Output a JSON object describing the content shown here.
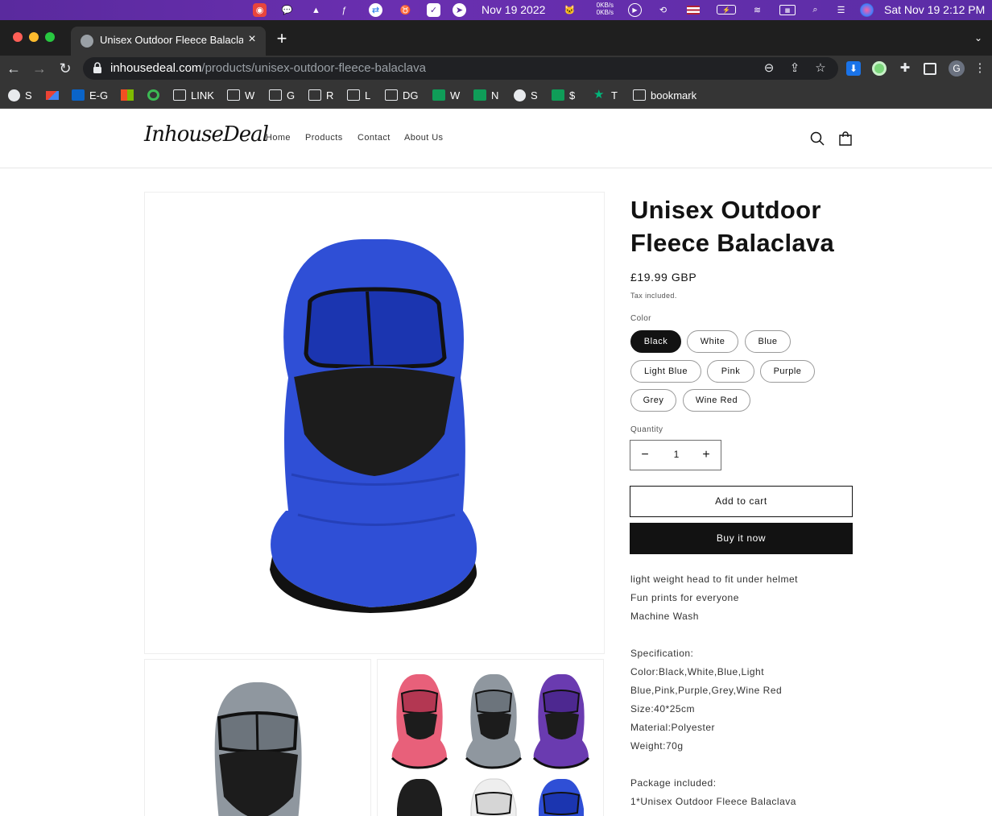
{
  "menubar": {
    "date_short": "Nov 19 2022",
    "net_up": "0KB/s",
    "net_down": "0KB/s",
    "datetime": "Sat Nov 19  2:12 PM"
  },
  "browser": {
    "tab_title": "Unisex Outdoor Fleece Balaclava",
    "url_domain": "inhousedeal.com",
    "url_path": "/products/unisex-outdoor-fleece-balaclava",
    "profile_initial": "G",
    "bookmarks": [
      {
        "label": "S",
        "icon": "globe-icon"
      },
      {
        "label": "",
        "icon": "gmail-icon"
      },
      {
        "label": "E-G",
        "icon": "outlook-icon"
      },
      {
        "label": "",
        "icon": "microsoft-icon"
      },
      {
        "label": "",
        "icon": "grammarly-icon"
      },
      {
        "label": "LINK",
        "icon": "folder-icon"
      },
      {
        "label": "W",
        "icon": "folder-icon"
      },
      {
        "label": "G",
        "icon": "folder-icon"
      },
      {
        "label": "R",
        "icon": "folder-icon"
      },
      {
        "label": "L",
        "icon": "folder-icon"
      },
      {
        "label": "DG",
        "icon": "folder-icon"
      },
      {
        "label": "W",
        "icon": "sheets-icon"
      },
      {
        "label": "N",
        "icon": "sheets-icon"
      },
      {
        "label": "S",
        "icon": "globe-icon"
      },
      {
        "label": "$",
        "icon": "sheets-icon"
      },
      {
        "label": "T",
        "icon": "star-icon"
      },
      {
        "label": "bookmark",
        "icon": "folder-icon"
      }
    ]
  },
  "site": {
    "logo": "InhouseDeal",
    "nav": [
      "Home",
      "Products",
      "Contact",
      "About Us"
    ]
  },
  "product": {
    "title": "Unisex Outdoor Fleece Balaclava",
    "price": "£19.99 GBP",
    "tax_note": "Tax included.",
    "color_label": "Color",
    "colors": [
      "Black",
      "White",
      "Blue",
      "Light Blue",
      "Pink",
      "Purple",
      "Grey",
      "Wine Red"
    ],
    "selected_color": "Black",
    "quantity_label": "Quantity",
    "quantity": "1",
    "qty_minus": "−",
    "qty_plus": "+",
    "add_to_cart": "Add to cart",
    "buy_now": "Buy it now",
    "description": [
      "light weight head to fit under helmet",
      "Fun prints for everyone",
      "Machine Wash",
      "",
      "Specification:",
      "Color:Black,White,Blue,Light",
      "Blue,Pink,Purple,Grey,Wine Red",
      "Size:40*25cm",
      "Material:Polyester",
      "Weight:70g",
      "",
      "Package included:",
      "1*Unisex Outdoor Fleece Balaclava"
    ]
  },
  "colors": {
    "accent_dark": "#121212",
    "balaclava_blue": "#2f4fd6",
    "menubar_purple": "#5a2a9e"
  }
}
